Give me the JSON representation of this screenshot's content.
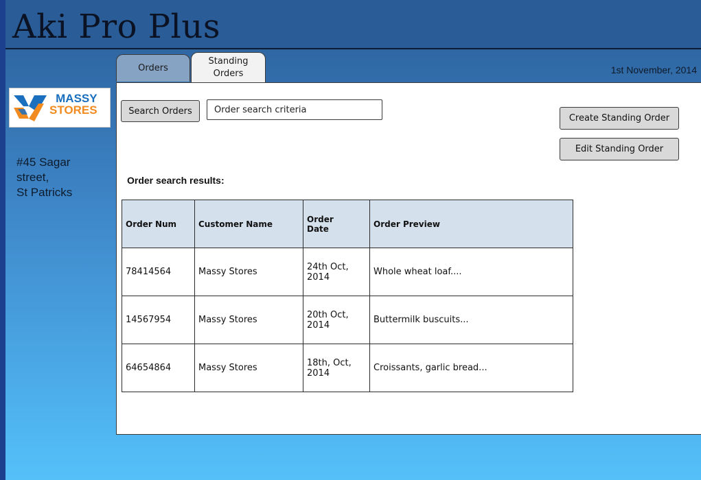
{
  "app": {
    "title": "Aki Pro Plus"
  },
  "tabs": [
    {
      "label": "Orders",
      "active": true
    },
    {
      "label": "Standing\nOrders",
      "active": false
    }
  ],
  "header": {
    "date": "1st November, 2014"
  },
  "store": {
    "logo_line1": "MASSY",
    "logo_line2": "STORES",
    "address_line1": "#45 Sagar",
    "address_line2": "street,",
    "address_line3": "St Patricks"
  },
  "search": {
    "button_label": "Search Orders",
    "placeholder": "Order search criteria"
  },
  "actions": {
    "create_label": "Create Standing Order",
    "edit_label": "Edit Standing Order"
  },
  "results": {
    "label": "Order search results:",
    "columns": [
      "Order Num",
      "Customer Name",
      "Order\nDate",
      "Order Preview"
    ],
    "rows": [
      {
        "order_num": "78414564",
        "customer": "Massy Stores",
        "date": "24th Oct,\n2014",
        "preview": "Whole wheat loaf...."
      },
      {
        "order_num": "14567954",
        "customer": "Massy Stores",
        "date": "20th Oct,\n2014",
        "preview": "Buttermilk buscuits..."
      },
      {
        "order_num": "64654864",
        "customer": "Massy Stores",
        "date": "18th, Oct,\n2014",
        "preview": "Croissants, garlic bread..."
      }
    ]
  },
  "colors": {
    "header_bg": "#2a5d97",
    "tab_active": "#86a3c4",
    "table_header": "#d4e0ec",
    "logo_blue": "#1a6fbf",
    "logo_orange": "#f28b1f"
  },
  "icons": {
    "logo": "massy-stores-logo"
  }
}
